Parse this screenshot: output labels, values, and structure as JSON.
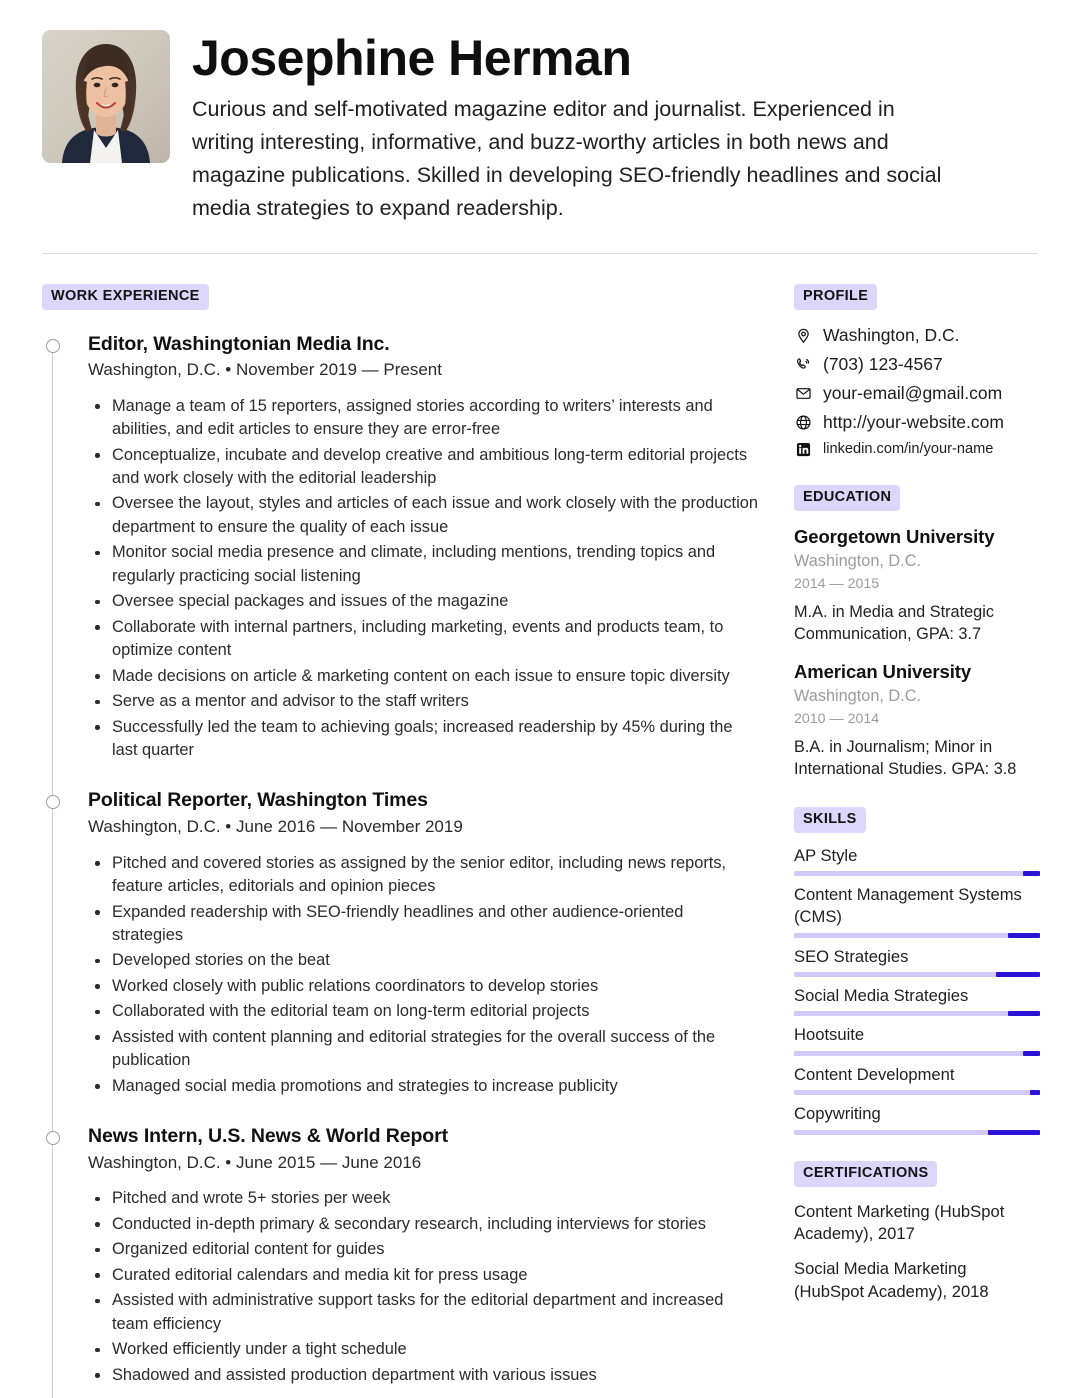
{
  "header": {
    "name": "Josephine Herman",
    "summary": "Curious and self-motivated magazine editor and journalist. Experienced in writing interesting, informative, and buzz-worthy articles in both news and magazine publications. Skilled in developing SEO-friendly headlines and social media strategies to expand readership.",
    "photo_alt": "profile-photo"
  },
  "colors": {
    "badge_bg": "#ddd6fb",
    "skill_track": "#d3c9fb",
    "skill_fill": "#2b13d6",
    "divider": "#dddddd",
    "muted_text": "#9b9b9b"
  },
  "work": {
    "heading": "WORK EXPERIENCE",
    "jobs": [
      {
        "title": "Editor, Washingtonian Media Inc.",
        "meta": "Washington, D.C. • November 2019 — Present",
        "bullets": [
          "Manage a team of 15 reporters, assigned stories according to writers’ interests and abilities, and edit articles to ensure they are error-free",
          "Conceptualize, incubate and develop creative and ambitious long-term editorial projects and work closely with the editorial leadership",
          "Oversee the layout, styles and articles of each issue and work closely with the production department to ensure the quality of each issue",
          "Monitor social media presence and climate, including mentions, trending topics and regularly practicing social listening",
          "Oversee special packages and issues of the magazine",
          "Collaborate with internal partners, including marketing, events and products team, to optimize content",
          "Made decisions on article & marketing content on each issue to ensure topic diversity",
          "Serve as a mentor and advisor to the staff writers",
          "Successfully led the team to achieving goals; increased readership by 45% during the last quarter"
        ]
      },
      {
        "title": "Political Reporter, Washington Times",
        "meta": "Washington, D.C. • June 2016 — November 2019",
        "bullets": [
          "Pitched and covered stories as assigned by the senior editor, including news reports, feature articles, editorials and opinion pieces",
          "Expanded readership with SEO-friendly headlines and other audience-oriented strategies",
          "Developed stories on the beat",
          "Worked closely with public relations coordinators to develop stories",
          "Collaborated with the editorial team on long-term editorial projects",
          "Assisted with content planning and editorial strategies for the overall success of the publication",
          "Managed social media promotions and strategies to increase publicity"
        ]
      },
      {
        "title": "News Intern, U.S. News & World Report",
        "meta": "Washington, D.C. • June 2015 — June 2016",
        "bullets": [
          "Pitched and wrote 5+ stories per week",
          "Conducted in-depth primary & secondary research, including interviews for stories",
          "Organized editorial content for guides",
          "Curated editorial calendars and media kit for press usage",
          "Assisted with administrative support tasks for the editorial department and increased team efficiency",
          "Worked efficiently under a tight schedule",
          "Shadowed and assisted production department with various issues"
        ]
      }
    ]
  },
  "profile": {
    "heading": "PROFILE",
    "contacts": [
      {
        "icon": "location-pin-icon",
        "text": "Washington, D.C.",
        "size": "normal"
      },
      {
        "icon": "phone-icon",
        "text": "(703) 123-4567",
        "size": "normal"
      },
      {
        "icon": "envelope-icon",
        "text": "your-email@gmail.com",
        "size": "normal"
      },
      {
        "icon": "globe-icon",
        "text": "http://your-website.com",
        "size": "normal"
      },
      {
        "icon": "linkedin-icon",
        "text": "linkedin.com/in/your-name",
        "size": "small"
      }
    ]
  },
  "education": {
    "heading": "EDUCATION",
    "items": [
      {
        "school": "Georgetown University",
        "location": "Washington, D.C.",
        "years": "2014 — 2015",
        "degree": "M.A. in Media and Strategic Communication, GPA: 3.7"
      },
      {
        "school": "American University",
        "location": "Washington, D.C.",
        "years": "2010 — 2014",
        "degree": "B.A. in Journalism; Minor in International Studies. GPA: 3.8"
      }
    ]
  },
  "skills": {
    "heading": "SKILLS",
    "items": [
      {
        "name": "AP Style",
        "level_start_pct": 93,
        "level_end_pct": 100
      },
      {
        "name": "Content Management Systems (CMS)",
        "level_start_pct": 87,
        "level_end_pct": 100
      },
      {
        "name": "SEO Strategies",
        "level_start_pct": 82,
        "level_end_pct": 100
      },
      {
        "name": "Social Media Strategies",
        "level_start_pct": 87,
        "level_end_pct": 100
      },
      {
        "name": "Hootsuite",
        "level_start_pct": 93,
        "level_end_pct": 100
      },
      {
        "name": "Content Development",
        "level_start_pct": 96,
        "level_end_pct": 100
      },
      {
        "name": "Copywriting",
        "level_start_pct": 79,
        "level_end_pct": 100
      }
    ]
  },
  "certifications": {
    "heading": "CERTIFICATIONS",
    "items": [
      "Content Marketing (HubSpot Academy), 2017",
      "Social Media Marketing (HubSpot Academy), 2018"
    ]
  }
}
